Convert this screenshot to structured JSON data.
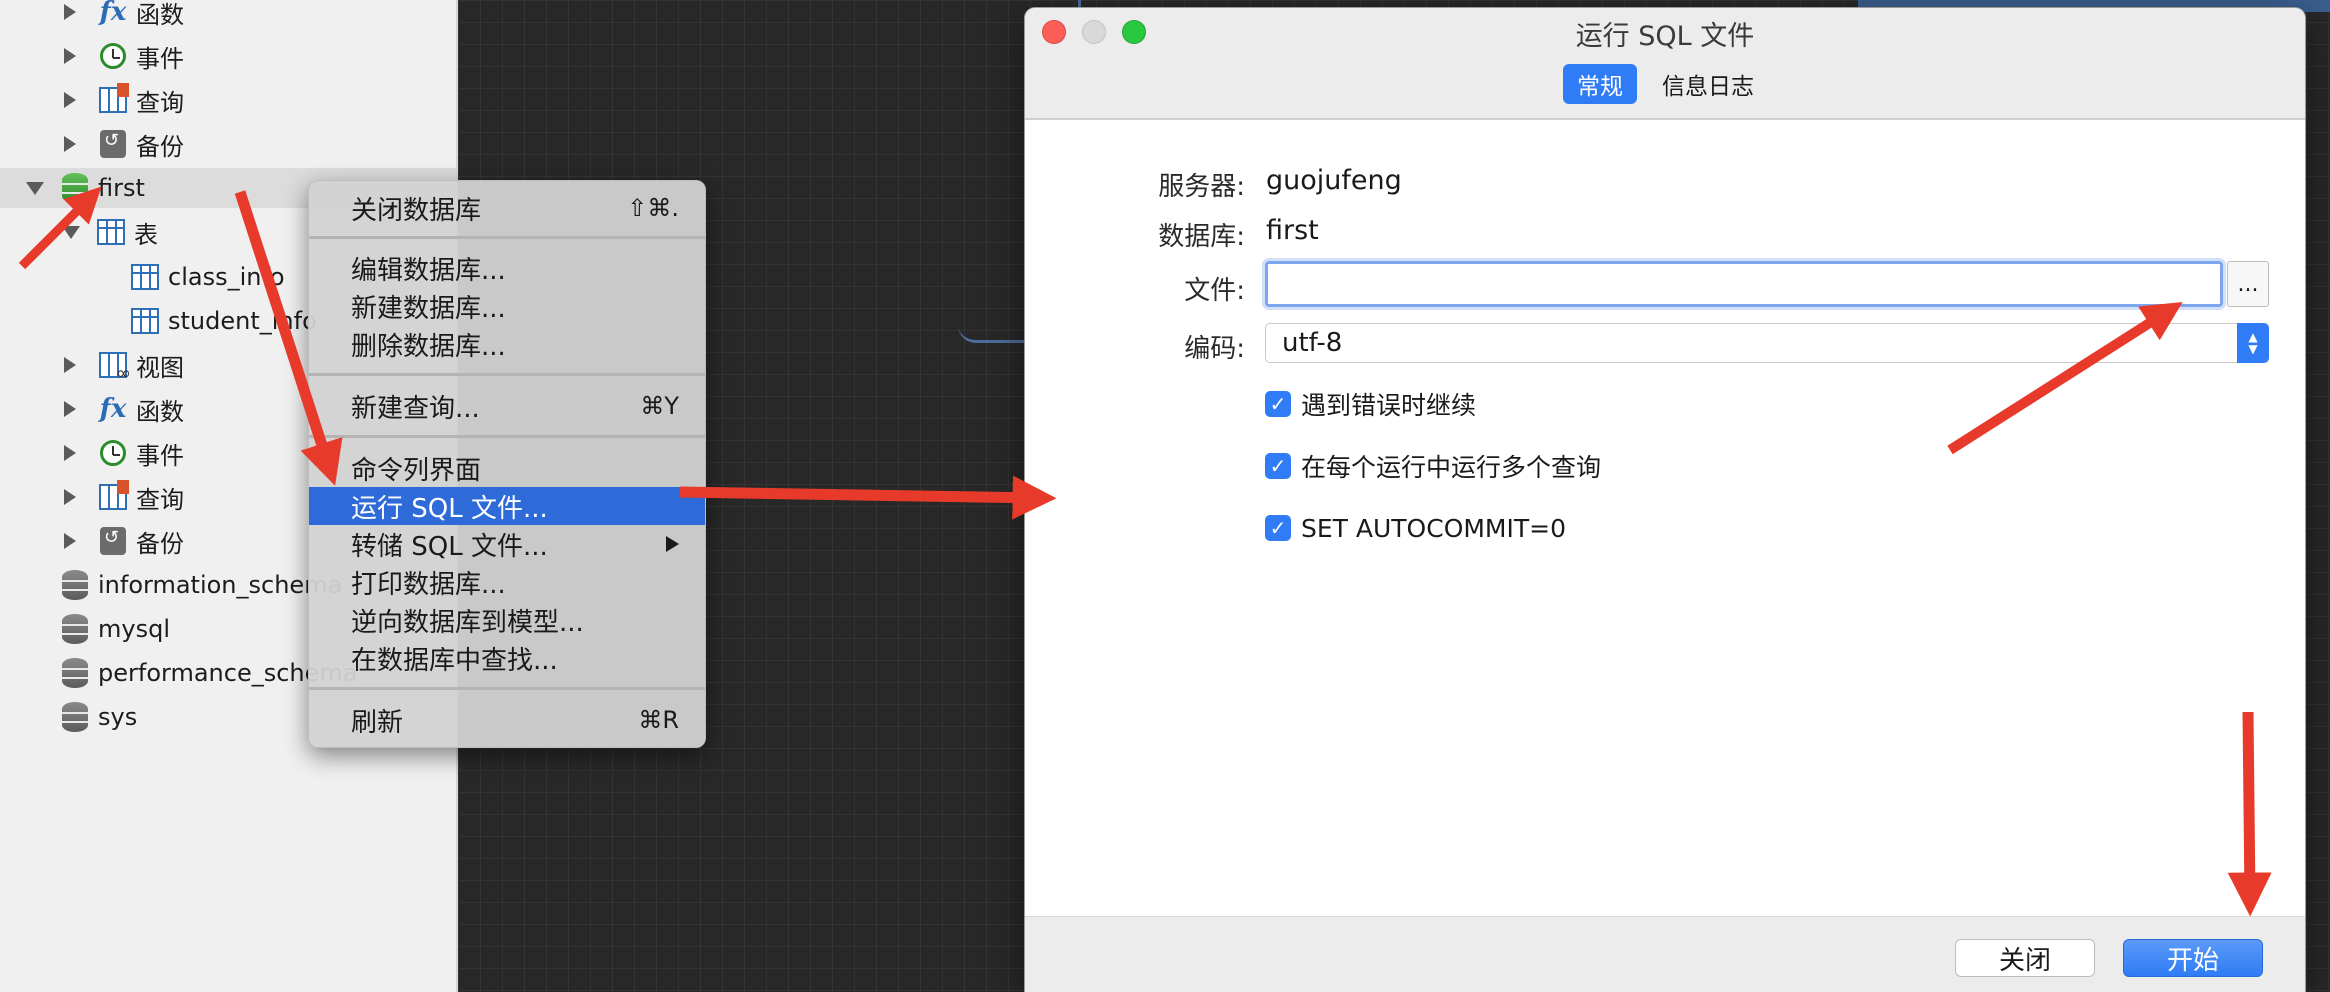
{
  "sidebar": {
    "items": [
      {
        "label": "函数",
        "icon": "function-icon"
      },
      {
        "label": "事件",
        "icon": "clock-icon"
      },
      {
        "label": "查询",
        "icon": "query-icon"
      },
      {
        "label": "备份",
        "icon": "backup-icon"
      },
      {
        "label": "first",
        "icon": "database-icon"
      },
      {
        "label": "表",
        "icon": "table-icon"
      },
      {
        "label": "class_info",
        "icon": "table-icon"
      },
      {
        "label": "student_info",
        "icon": "table-icon"
      },
      {
        "label": "视图",
        "icon": "view-icon"
      },
      {
        "label": "函数",
        "icon": "function-icon"
      },
      {
        "label": "事件",
        "icon": "clock-icon"
      },
      {
        "label": "查询",
        "icon": "query-icon"
      },
      {
        "label": "备份",
        "icon": "backup-icon"
      },
      {
        "label": "information_schema",
        "icon": "database-icon"
      },
      {
        "label": "mysql",
        "icon": "database-icon"
      },
      {
        "label": "performance_schema",
        "icon": "database-icon"
      },
      {
        "label": "sys",
        "icon": "database-icon"
      }
    ]
  },
  "context_menu": {
    "items": [
      {
        "label": "关闭数据库",
        "shortcut": "⇧⌘."
      },
      {
        "label": "编辑数据库...",
        "shortcut": ""
      },
      {
        "label": "新建数据库...",
        "shortcut": ""
      },
      {
        "label": "删除数据库...",
        "shortcut": ""
      },
      {
        "label": "新建查询...",
        "shortcut": "⌘Y"
      },
      {
        "label": "命令列界面",
        "shortcut": ""
      },
      {
        "label": "运行 SQL 文件...",
        "shortcut": ""
      },
      {
        "label": "转储 SQL 文件...",
        "shortcut": ""
      },
      {
        "label": "打印数据库...",
        "shortcut": ""
      },
      {
        "label": "逆向数据库到模型...",
        "shortcut": ""
      },
      {
        "label": "在数据库中查找...",
        "shortcut": ""
      },
      {
        "label": "刷新",
        "shortcut": "⌘R"
      }
    ]
  },
  "dialog": {
    "title": "运行 SQL 文件",
    "tabs": [
      "常规",
      "信息日志"
    ],
    "server_label": "服务器:",
    "server_value": "guojufeng",
    "database_label": "数据库:",
    "database_value": "first",
    "file_label": "文件:",
    "file_value": "",
    "browse_label": "...",
    "encoding_label": "编码:",
    "encoding_value": "utf-8",
    "options": [
      {
        "label": "遇到错误时继续",
        "checked": true
      },
      {
        "label": "在每个运行中运行多个查询",
        "checked": true
      },
      {
        "label": "SET AUTOCOMMIT=0",
        "checked": true
      }
    ],
    "close_label": "关闭",
    "start_label": "开始"
  },
  "colors": {
    "accent": "#2f7cf6",
    "menu_highlight": "#2e6bd9",
    "annotation_arrow": "#e83a2a"
  }
}
